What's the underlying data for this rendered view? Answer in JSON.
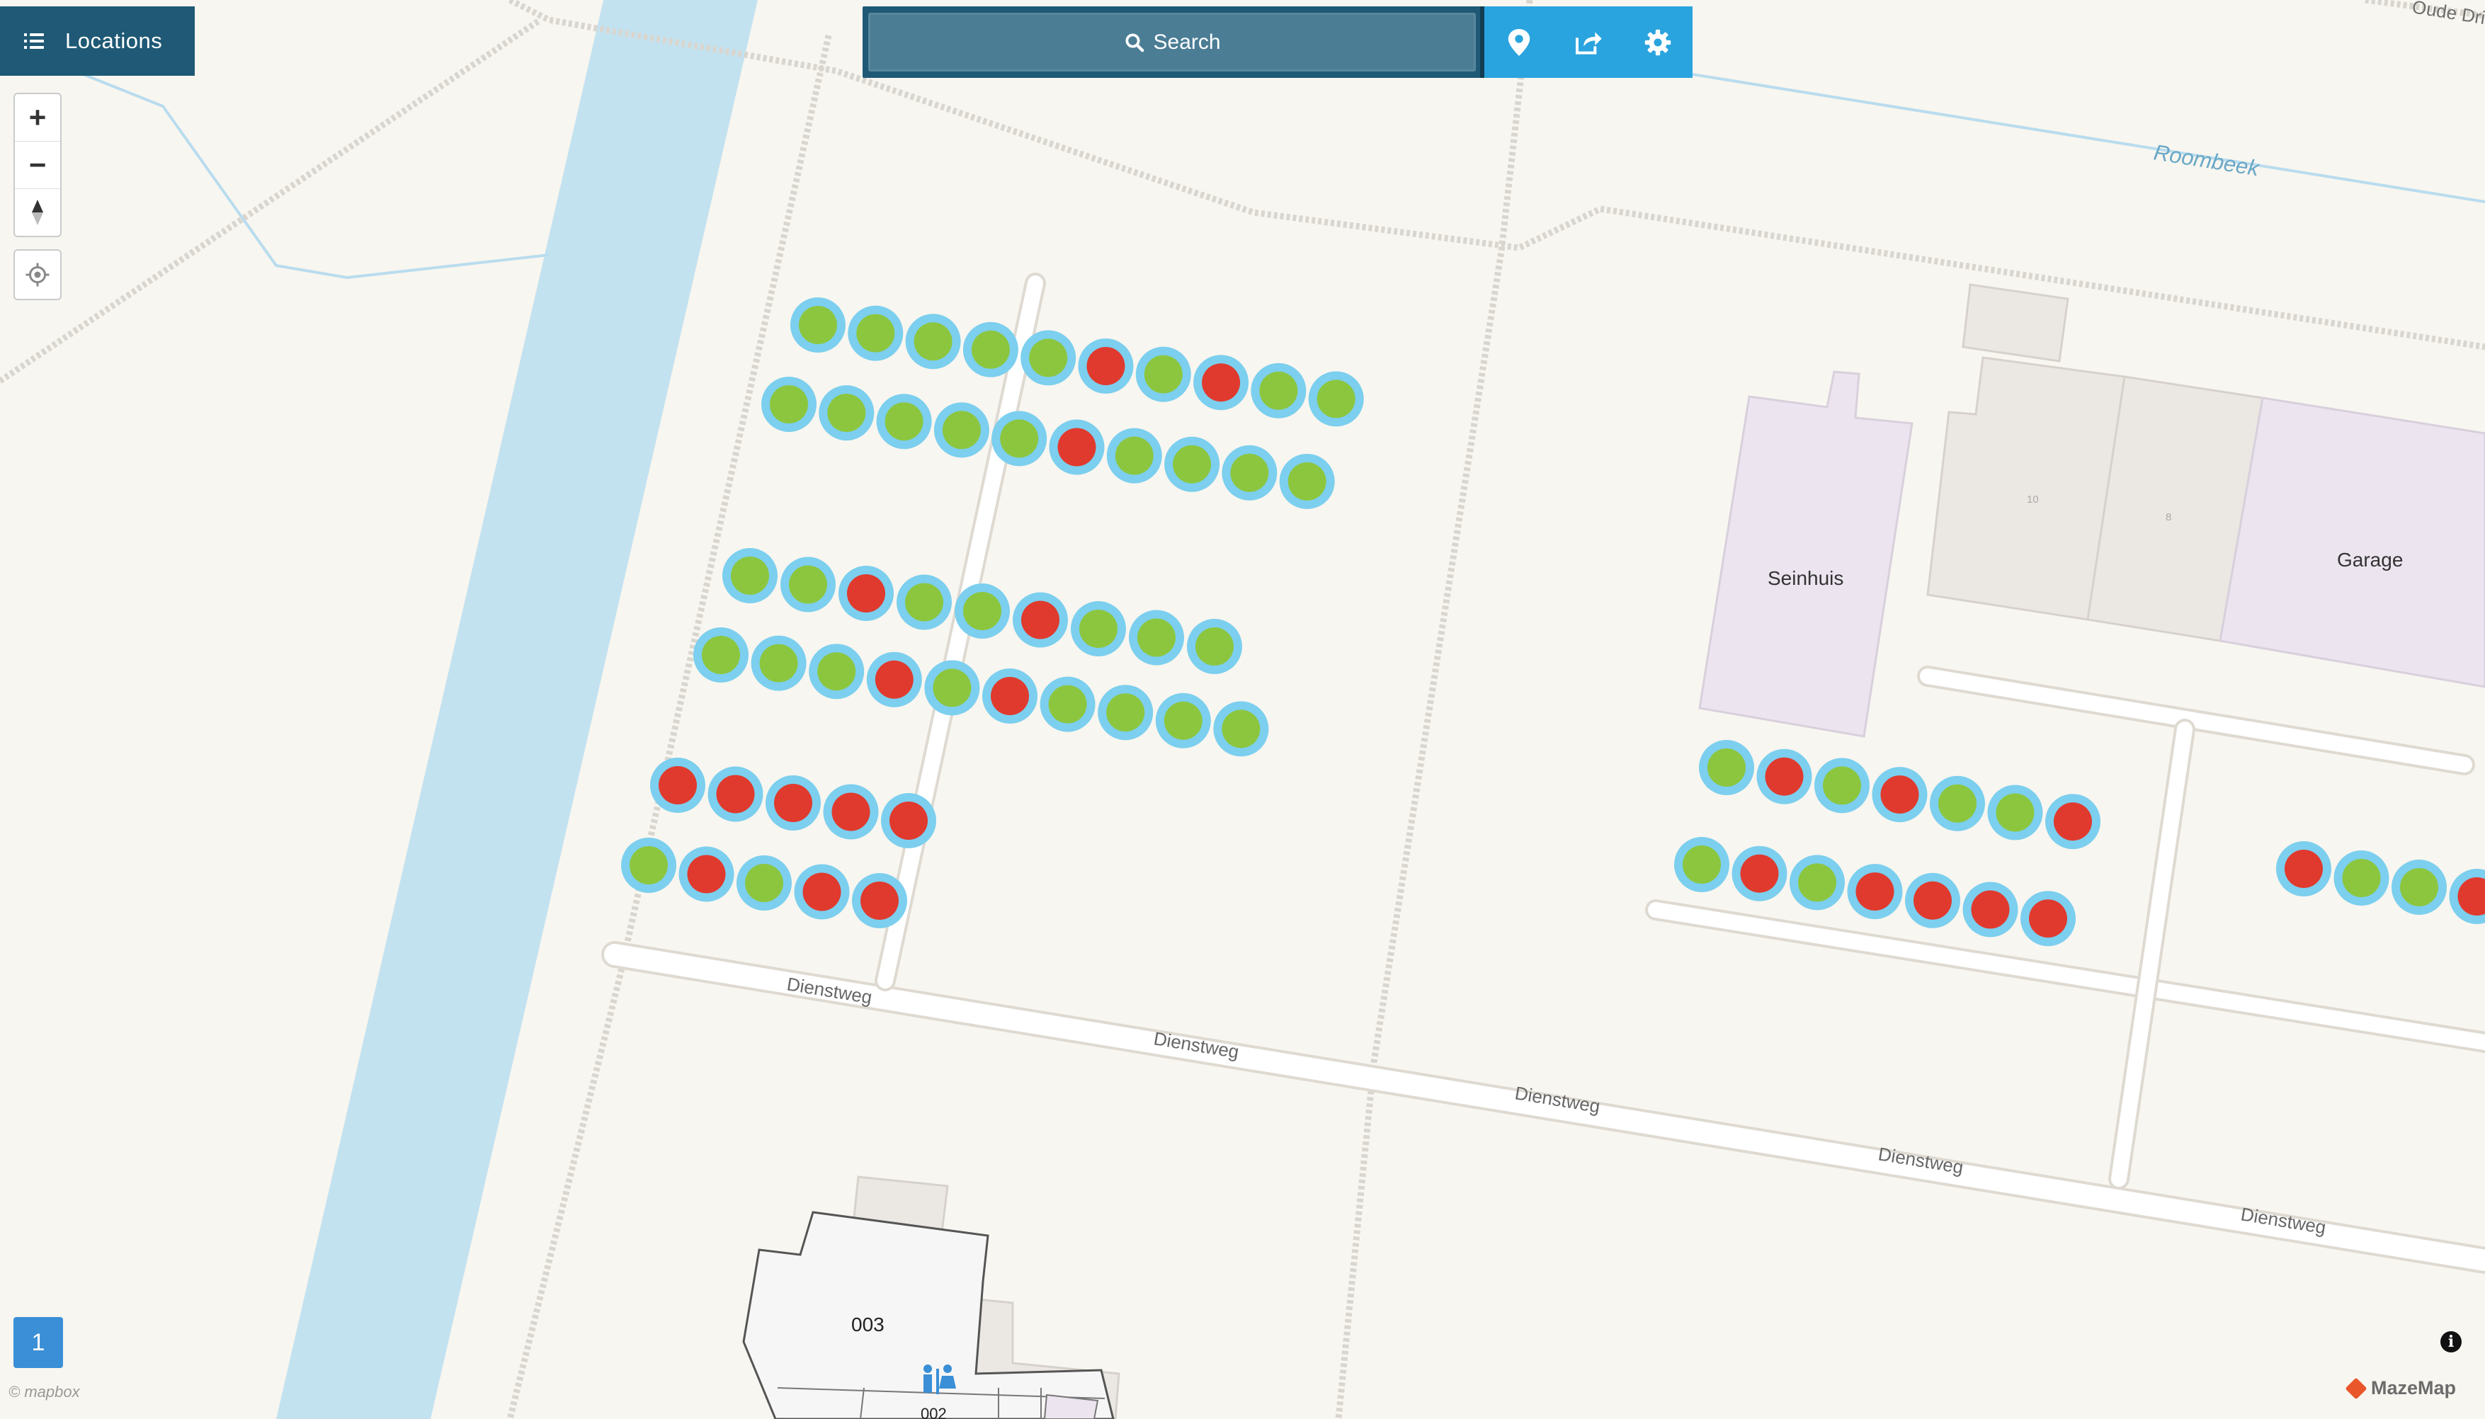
{
  "app": {
    "locations_label": "Locations",
    "search_label": "Search",
    "floor_label": "1",
    "zoom_in": "+",
    "zoom_out": "−",
    "attribution_left": "© mapbox",
    "attribution_right": "MazeMap",
    "info_label": "i"
  },
  "colors": {
    "topbar": "#1f5975",
    "search_box": "#4b7d95",
    "action_buttons": "#2aa4de",
    "available": "#8cc63f",
    "occupied": "#e03a2e",
    "marker_ring": "#7ccfee",
    "water": "#c3e2f0",
    "land": "#f8f6f0"
  },
  "icons": [
    "list-icon",
    "search-icon",
    "location-pin-icon",
    "share-icon",
    "gear-icon",
    "compass-icon",
    "locate-icon",
    "toilet-icon",
    "info-icon",
    "mazemap-logo-icon"
  ],
  "labels": {
    "oude_dr": "Oude Dri",
    "roombeek": "Roombeek",
    "seinhuis": "Seinhuis",
    "garage": "Garage",
    "bldg_10": "10",
    "bldg_8": "8",
    "room_003": "003",
    "room_002": "002",
    "dienstweg": "Dienstweg"
  },
  "markers": {
    "row1": [
      "available",
      "available",
      "available",
      "available",
      "available",
      "occupied",
      "available",
      "occupied",
      "available",
      "available"
    ],
    "row2": [
      "available",
      "available",
      "available",
      "available",
      "available",
      "occupied",
      "available",
      "available",
      "available",
      "available"
    ],
    "row3": [
      "available",
      "available",
      "occupied",
      "available",
      "available",
      "occupied",
      "available",
      "available",
      "available"
    ],
    "row4": [
      "available",
      "available",
      "available",
      "occupied",
      "available",
      "occupied",
      "available",
      "available",
      "available",
      "available"
    ],
    "row5": [
      "occupied",
      "occupied",
      "occupied",
      "occupied",
      "occupied"
    ],
    "row6": [
      "available",
      "occupied",
      "available",
      "occupied",
      "occupied"
    ],
    "row7": [
      "available",
      "occupied",
      "available",
      "occupied",
      "available",
      "available",
      "occupied"
    ],
    "row8": [
      "available",
      "occupied",
      "available",
      "occupied",
      "occupied",
      "occupied",
      "occupied"
    ],
    "row9": [
      "occupied",
      "available",
      "available",
      "occupied"
    ]
  }
}
